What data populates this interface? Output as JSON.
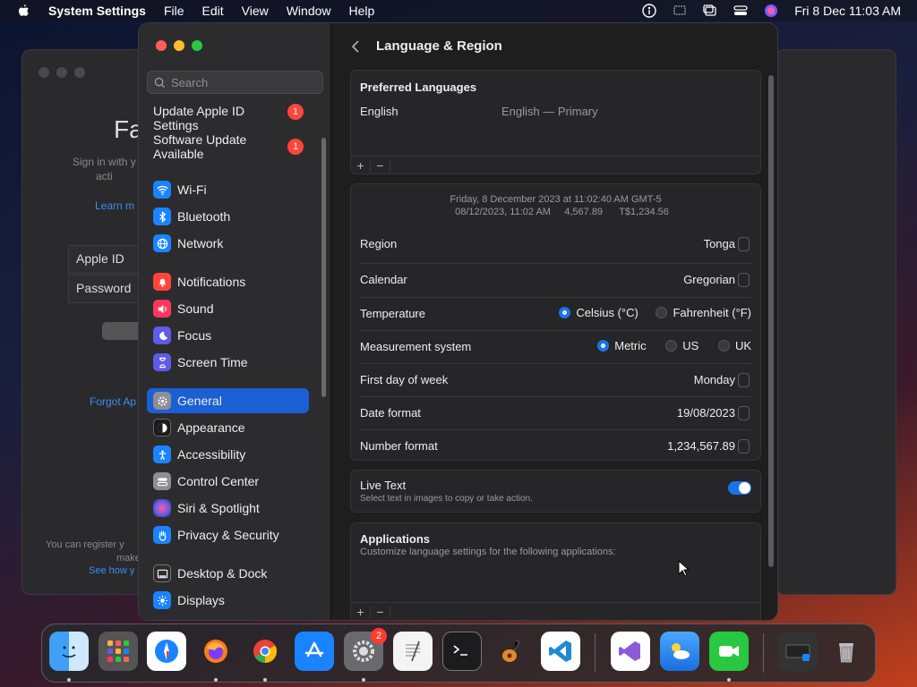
{
  "menubar": {
    "app_name": "System Settings",
    "items": [
      "File",
      "Edit",
      "View",
      "Window",
      "Help"
    ],
    "clock": "Fri 8 Dec  11:03 AM"
  },
  "background_window": {
    "title_fragment": "Fa",
    "subtitle": "Sign in with y\nacti",
    "learn_more": "Learn m",
    "apple_id_label": "Apple ID",
    "password_label": "Password",
    "forgot": "Forgot Ap",
    "footer": "You can register y",
    "footer2": "make",
    "see_how": "See how y"
  },
  "sidebar": {
    "search_placeholder": "Search",
    "update_apple_id": "Update Apple ID Settings",
    "update_apple_id_badge": "1",
    "software_update": "Software Update Available",
    "software_update_badge": "1",
    "items": [
      {
        "label": "Wi-Fi",
        "icon": "wifi-icon",
        "color": "#1a84ff"
      },
      {
        "label": "Bluetooth",
        "icon": "bluetooth-icon",
        "color": "#1a84ff"
      },
      {
        "label": "Network",
        "icon": "network-globe-icon",
        "color": "#1a84ff"
      },
      {
        "label": "Notifications",
        "icon": "bell-icon",
        "color": "#ff453a"
      },
      {
        "label": "Sound",
        "icon": "speaker-icon",
        "color": "#ff375f"
      },
      {
        "label": "Focus",
        "icon": "moon-icon",
        "color": "#5e5ce6"
      },
      {
        "label": "Screen Time",
        "icon": "hourglass-icon",
        "color": "#5e5ce6"
      },
      {
        "label": "General",
        "icon": "gear-icon",
        "color": "#8e8e93"
      },
      {
        "label": "Appearance",
        "icon": "appearance-icon",
        "color": "#1c1c1e"
      },
      {
        "label": "Accessibility",
        "icon": "accessibility-icon",
        "color": "#1a84ff"
      },
      {
        "label": "Control Center",
        "icon": "control-center-icon",
        "color": "#8e8e93"
      },
      {
        "label": "Siri & Spotlight",
        "icon": "siri-icon",
        "color": "#8e44ad"
      },
      {
        "label": "Privacy & Security",
        "icon": "hand-icon",
        "color": "#1a84ff"
      },
      {
        "label": "Desktop & Dock",
        "icon": "dock-icon",
        "color": "#2c2c2e"
      },
      {
        "label": "Displays",
        "icon": "sun-icon",
        "color": "#1a84ff"
      }
    ]
  },
  "content": {
    "title": "Language & Region",
    "preferred_languages": {
      "heading": "Preferred Languages",
      "language": "English",
      "language_detail": "English — Primary",
      "add": "+",
      "remove": "−"
    },
    "preview": {
      "line1": "Friday, 8 December 2023 at 11:02:40 AM GMT-5",
      "line2_date": "08/12/2023, 11:02 AM",
      "line2_number": "4,567.89",
      "line2_currency": "T$1,234.56"
    },
    "rows": {
      "region_label": "Region",
      "region_value": "Tonga",
      "calendar_label": "Calendar",
      "calendar_value": "Gregorian",
      "temperature_label": "Temperature",
      "celsius": "Celsius (°C)",
      "fahrenheit": "Fahrenheit (°F)",
      "measurement_label": "Measurement system",
      "metric": "Metric",
      "us": "US",
      "uk": "UK",
      "first_day_label": "First day of week",
      "first_day_value": "Monday",
      "date_format_label": "Date format",
      "date_format_value": "19/08/2023",
      "number_format_label": "Number format",
      "number_format_value": "1,234,567.89"
    },
    "live_text": {
      "title": "Live Text",
      "subtitle": "Select text in images to copy or take action."
    },
    "applications": {
      "heading": "Applications",
      "subtitle": "Customize language settings for the following applications:",
      "add": "+",
      "remove": "−"
    }
  },
  "dock": {
    "settings_badge": "2"
  }
}
